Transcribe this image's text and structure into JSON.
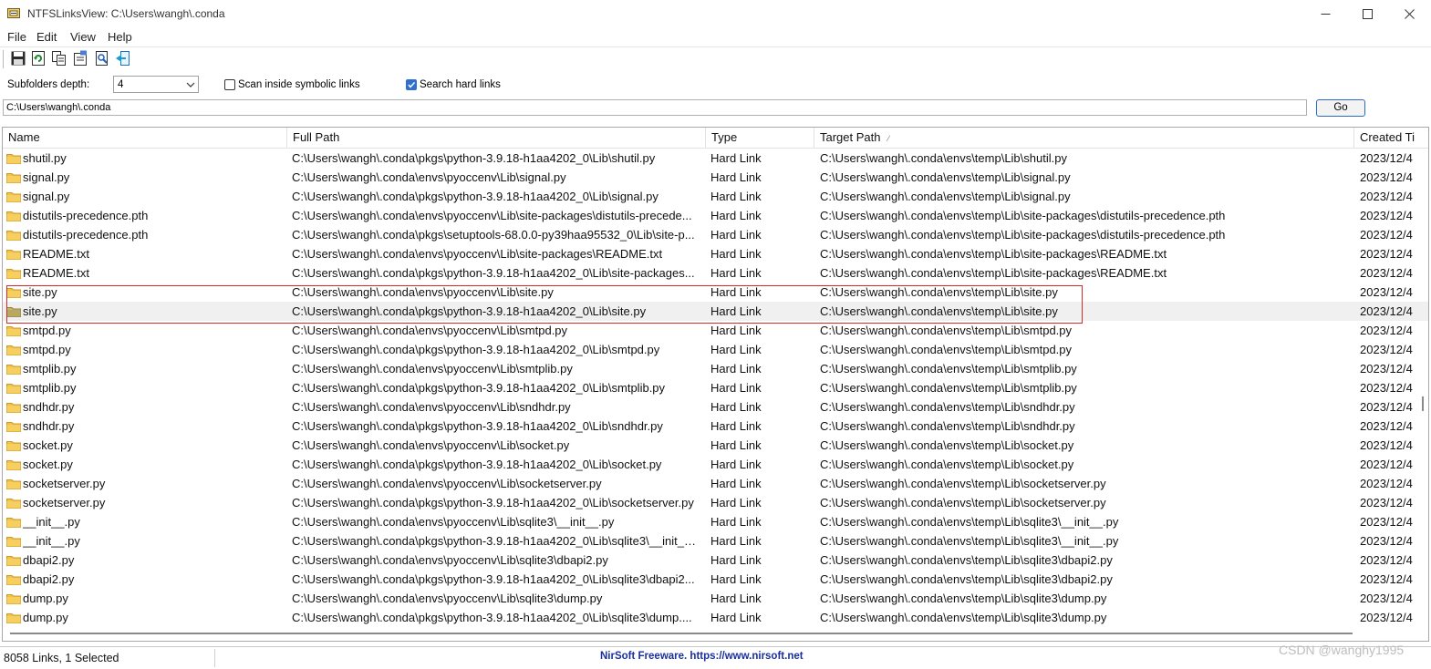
{
  "window": {
    "title": "NTFSLinksView:  C:\\Users\\wangh\\.conda"
  },
  "menu": [
    "File",
    "Edit",
    "View",
    "Help"
  ],
  "toolbar": {
    "buttons": [
      "save-icon",
      "refresh-icon",
      "copy-icon",
      "properties-icon",
      "find-icon",
      "exit-icon"
    ]
  },
  "options": {
    "depth_label": "Subfolders depth:",
    "depth_value": "4",
    "scan_symbolic_label": "Scan inside symbolic links",
    "scan_symbolic_checked": false,
    "search_hard_label": "Search hard links",
    "search_hard_checked": true
  },
  "path": {
    "value": "C:\\Users\\wangh\\.conda",
    "go_label": "Go"
  },
  "table": {
    "columns": [
      "Name",
      "Full Path",
      "Type",
      "Target Path",
      "Created Ti"
    ],
    "sort_indicator": "⁄",
    "selected_index": 8,
    "rows": [
      {
        "name": "shutil.py",
        "full": "C:\\Users\\wangh\\.conda\\pkgs\\python-3.9.18-h1aa4202_0\\Lib\\shutil.py",
        "type": "Hard Link",
        "target": "C:\\Users\\wangh\\.conda\\envs\\temp\\Lib\\shutil.py",
        "created": "2023/12/4"
      },
      {
        "name": "signal.py",
        "full": "C:\\Users\\wangh\\.conda\\envs\\pyoccenv\\Lib\\signal.py",
        "type": "Hard Link",
        "target": "C:\\Users\\wangh\\.conda\\envs\\temp\\Lib\\signal.py",
        "created": "2023/12/4"
      },
      {
        "name": "signal.py",
        "full": "C:\\Users\\wangh\\.conda\\pkgs\\python-3.9.18-h1aa4202_0\\Lib\\signal.py",
        "type": "Hard Link",
        "target": "C:\\Users\\wangh\\.conda\\envs\\temp\\Lib\\signal.py",
        "created": "2023/12/4"
      },
      {
        "name": "distutils-precedence.pth",
        "full": "C:\\Users\\wangh\\.conda\\envs\\pyoccenv\\Lib\\site-packages\\distutils-precede...",
        "type": "Hard Link",
        "target": "C:\\Users\\wangh\\.conda\\envs\\temp\\Lib\\site-packages\\distutils-precedence.pth",
        "created": "2023/12/4"
      },
      {
        "name": "distutils-precedence.pth",
        "full": "C:\\Users\\wangh\\.conda\\pkgs\\setuptools-68.0.0-py39haa95532_0\\Lib\\site-p...",
        "type": "Hard Link",
        "target": "C:\\Users\\wangh\\.conda\\envs\\temp\\Lib\\site-packages\\distutils-precedence.pth",
        "created": "2023/12/4"
      },
      {
        "name": "README.txt",
        "full": "C:\\Users\\wangh\\.conda\\envs\\pyoccenv\\Lib\\site-packages\\README.txt",
        "type": "Hard Link",
        "target": "C:\\Users\\wangh\\.conda\\envs\\temp\\Lib\\site-packages\\README.txt",
        "created": "2023/12/4"
      },
      {
        "name": "README.txt",
        "full": "C:\\Users\\wangh\\.conda\\pkgs\\python-3.9.18-h1aa4202_0\\Lib\\site-packages...",
        "type": "Hard Link",
        "target": "C:\\Users\\wangh\\.conda\\envs\\temp\\Lib\\site-packages\\README.txt",
        "created": "2023/12/4"
      },
      {
        "name": "site.py",
        "full": "C:\\Users\\wangh\\.conda\\envs\\pyoccenv\\Lib\\site.py",
        "type": "Hard Link",
        "target": "C:\\Users\\wangh\\.conda\\envs\\temp\\Lib\\site.py",
        "created": "2023/12/4"
      },
      {
        "name": "site.py",
        "full": "C:\\Users\\wangh\\.conda\\pkgs\\python-3.9.18-h1aa4202_0\\Lib\\site.py",
        "type": "Hard Link",
        "target": "C:\\Users\\wangh\\.conda\\envs\\temp\\Lib\\site.py",
        "created": "2023/12/4"
      },
      {
        "name": "smtpd.py",
        "full": "C:\\Users\\wangh\\.conda\\envs\\pyoccenv\\Lib\\smtpd.py",
        "type": "Hard Link",
        "target": "C:\\Users\\wangh\\.conda\\envs\\temp\\Lib\\smtpd.py",
        "created": "2023/12/4"
      },
      {
        "name": "smtpd.py",
        "full": "C:\\Users\\wangh\\.conda\\pkgs\\python-3.9.18-h1aa4202_0\\Lib\\smtpd.py",
        "type": "Hard Link",
        "target": "C:\\Users\\wangh\\.conda\\envs\\temp\\Lib\\smtpd.py",
        "created": "2023/12/4"
      },
      {
        "name": "smtplib.py",
        "full": "C:\\Users\\wangh\\.conda\\envs\\pyoccenv\\Lib\\smtplib.py",
        "type": "Hard Link",
        "target": "C:\\Users\\wangh\\.conda\\envs\\temp\\Lib\\smtplib.py",
        "created": "2023/12/4"
      },
      {
        "name": "smtplib.py",
        "full": "C:\\Users\\wangh\\.conda\\pkgs\\python-3.9.18-h1aa4202_0\\Lib\\smtplib.py",
        "type": "Hard Link",
        "target": "C:\\Users\\wangh\\.conda\\envs\\temp\\Lib\\smtplib.py",
        "created": "2023/12/4"
      },
      {
        "name": "sndhdr.py",
        "full": "C:\\Users\\wangh\\.conda\\envs\\pyoccenv\\Lib\\sndhdr.py",
        "type": "Hard Link",
        "target": "C:\\Users\\wangh\\.conda\\envs\\temp\\Lib\\sndhdr.py",
        "created": "2023/12/4"
      },
      {
        "name": "sndhdr.py",
        "full": "C:\\Users\\wangh\\.conda\\pkgs\\python-3.9.18-h1aa4202_0\\Lib\\sndhdr.py",
        "type": "Hard Link",
        "target": "C:\\Users\\wangh\\.conda\\envs\\temp\\Lib\\sndhdr.py",
        "created": "2023/12/4"
      },
      {
        "name": "socket.py",
        "full": "C:\\Users\\wangh\\.conda\\envs\\pyoccenv\\Lib\\socket.py",
        "type": "Hard Link",
        "target": "C:\\Users\\wangh\\.conda\\envs\\temp\\Lib\\socket.py",
        "created": "2023/12/4"
      },
      {
        "name": "socket.py",
        "full": "C:\\Users\\wangh\\.conda\\pkgs\\python-3.9.18-h1aa4202_0\\Lib\\socket.py",
        "type": "Hard Link",
        "target": "C:\\Users\\wangh\\.conda\\envs\\temp\\Lib\\socket.py",
        "created": "2023/12/4"
      },
      {
        "name": "socketserver.py",
        "full": "C:\\Users\\wangh\\.conda\\envs\\pyoccenv\\Lib\\socketserver.py",
        "type": "Hard Link",
        "target": "C:\\Users\\wangh\\.conda\\envs\\temp\\Lib\\socketserver.py",
        "created": "2023/12/4"
      },
      {
        "name": "socketserver.py",
        "full": "C:\\Users\\wangh\\.conda\\pkgs\\python-3.9.18-h1aa4202_0\\Lib\\socketserver.py",
        "type": "Hard Link",
        "target": "C:\\Users\\wangh\\.conda\\envs\\temp\\Lib\\socketserver.py",
        "created": "2023/12/4"
      },
      {
        "name": "__init__.py",
        "full": "C:\\Users\\wangh\\.conda\\envs\\pyoccenv\\Lib\\sqlite3\\__init__.py",
        "type": "Hard Link",
        "target": "C:\\Users\\wangh\\.conda\\envs\\temp\\Lib\\sqlite3\\__init__.py",
        "created": "2023/12/4"
      },
      {
        "name": "__init__.py",
        "full": "C:\\Users\\wangh\\.conda\\pkgs\\python-3.9.18-h1aa4202_0\\Lib\\sqlite3\\__init__....",
        "type": "Hard Link",
        "target": "C:\\Users\\wangh\\.conda\\envs\\temp\\Lib\\sqlite3\\__init__.py",
        "created": "2023/12/4"
      },
      {
        "name": "dbapi2.py",
        "full": "C:\\Users\\wangh\\.conda\\envs\\pyoccenv\\Lib\\sqlite3\\dbapi2.py",
        "type": "Hard Link",
        "target": "C:\\Users\\wangh\\.conda\\envs\\temp\\Lib\\sqlite3\\dbapi2.py",
        "created": "2023/12/4"
      },
      {
        "name": "dbapi2.py",
        "full": "C:\\Users\\wangh\\.conda\\pkgs\\python-3.9.18-h1aa4202_0\\Lib\\sqlite3\\dbapi2...",
        "type": "Hard Link",
        "target": "C:\\Users\\wangh\\.conda\\envs\\temp\\Lib\\sqlite3\\dbapi2.py",
        "created": "2023/12/4"
      },
      {
        "name": "dump.py",
        "full": "C:\\Users\\wangh\\.conda\\envs\\pyoccenv\\Lib\\sqlite3\\dump.py",
        "type": "Hard Link",
        "target": "C:\\Users\\wangh\\.conda\\envs\\temp\\Lib\\sqlite3\\dump.py",
        "created": "2023/12/4"
      },
      {
        "name": "dump.py",
        "full": "C:\\Users\\wangh\\.conda\\pkgs\\python-3.9.18-h1aa4202_0\\Lib\\sqlite3\\dump....",
        "type": "Hard Link",
        "target": "C:\\Users\\wangh\\.conda\\envs\\temp\\Lib\\sqlite3\\dump.py",
        "created": "2023/12/4"
      }
    ]
  },
  "status": {
    "count": "8058 Links, 1 Selected",
    "link": "NirSoft Freeware. https://www.nirsoft.net"
  },
  "watermark": "CSDN @wanghy1995",
  "colors": {
    "highlight_box": "#d42a2a",
    "checkbox_checked": "#2f6fd1",
    "folder": "#f2c24b",
    "status_link": "#1a2fa0"
  }
}
